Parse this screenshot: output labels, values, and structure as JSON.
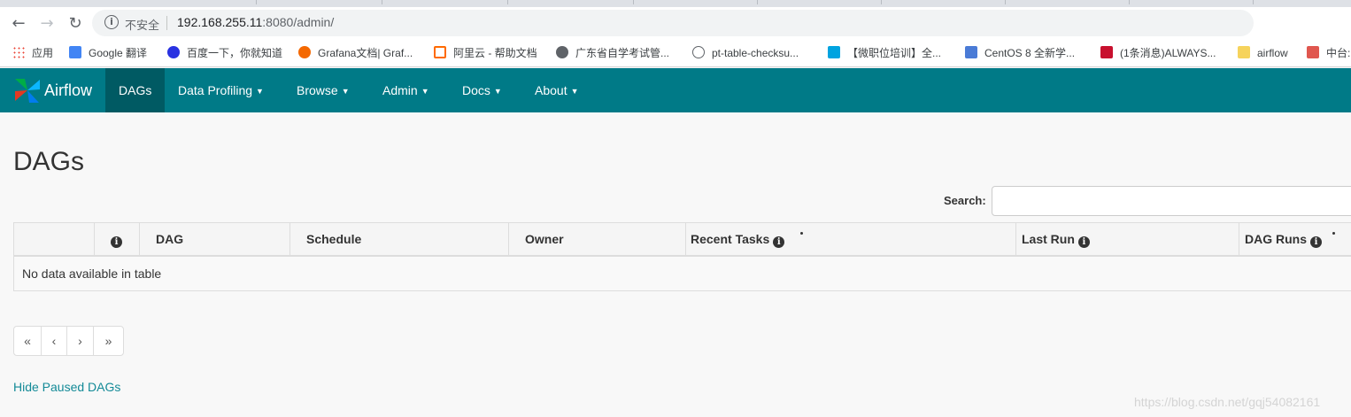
{
  "browser": {
    "insecure_label": "不安全",
    "url_host": "192.168.255.11",
    "url_rest": ":8080/admin/",
    "bookmarks": [
      {
        "label": "应用",
        "color": "#4285f4"
      },
      {
        "label": "Google 翻译",
        "color": "#4285f4"
      },
      {
        "label": "百度一下，你就知道",
        "color": "#2932e1"
      },
      {
        "label": "Grafana文档| Graf...",
        "color": "#f46800"
      },
      {
        "label": "阿里云 - 帮助文档",
        "color": "#ff6a00"
      },
      {
        "label": "广东省自学考试管...",
        "color": "#5f6368"
      },
      {
        "label": "pt-table-checksu...",
        "color": "#5f6368"
      },
      {
        "label": "【微职位培训】全...",
        "color": "#00a3e0"
      },
      {
        "label": "CentOS 8 全新学...",
        "color": "#4a7bd6"
      },
      {
        "label": "(1条消息)ALWAYS...",
        "color": "#c8102e"
      },
      {
        "label": "airflow",
        "color": "#f6d35c"
      },
      {
        "label": "中台:",
        "color": "#e0574f"
      }
    ]
  },
  "navbar": {
    "brand": "Airflow",
    "items": [
      {
        "label": "DAGs",
        "caret": ""
      },
      {
        "label": "Data Profiling",
        "caret": "▼"
      },
      {
        "label": "Browse",
        "caret": "▼"
      },
      {
        "label": "Admin",
        "caret": "▼"
      },
      {
        "label": "Docs",
        "caret": "▼"
      },
      {
        "label": "About",
        "caret": "▼"
      }
    ]
  },
  "page": {
    "title": "DAGs",
    "search_label": "Search:",
    "search_value": ""
  },
  "table": {
    "columns": [
      "",
      "",
      "DAG",
      "Schedule",
      "Owner",
      "Recent Tasks",
      "Last Run",
      "DAG Runs"
    ],
    "empty_message": "No data available in table"
  },
  "pager": [
    "«",
    "‹",
    "›",
    "»"
  ],
  "hide_paused_link": "Hide Paused DAGs",
  "watermark": "https://blog.csdn.net/gqj54082161"
}
